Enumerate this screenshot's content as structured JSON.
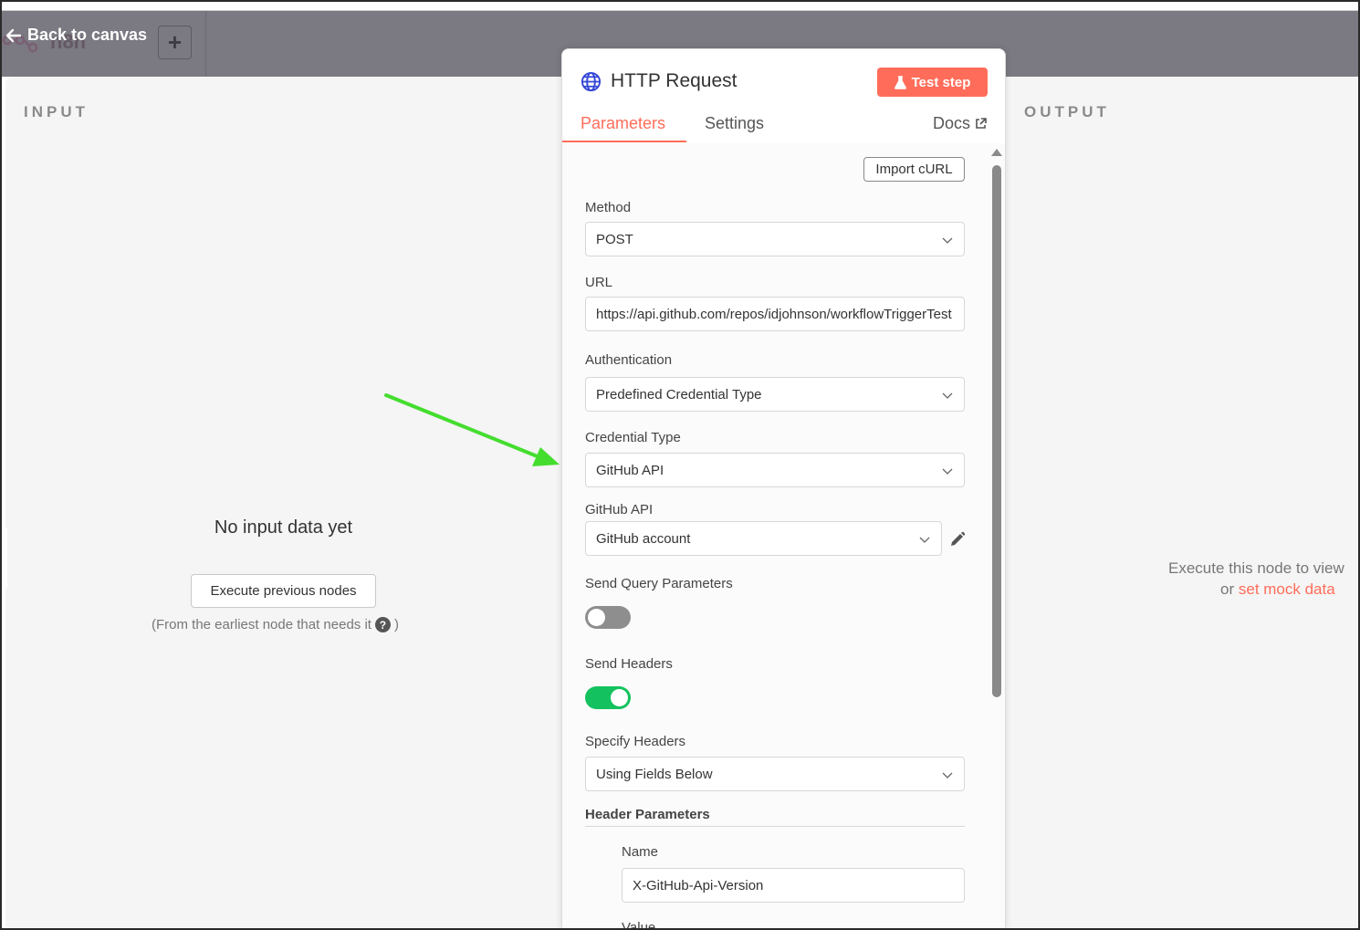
{
  "header": {
    "back_label": "Back to canvas",
    "app_name_ghost": "n8n",
    "add_label": "+"
  },
  "input_pane": {
    "title": "INPUT",
    "empty_message": "No input data yet",
    "execute_button": "Execute previous nodes",
    "note_prefix": "(From the earliest node that needs it",
    "note_suffix": ")",
    "help_icon": "?"
  },
  "output_pane": {
    "title": "OUTPUT",
    "message_line1": "Execute this node to view",
    "message_or": "or",
    "mock_link": "set mock data"
  },
  "node": {
    "icon": "globe-icon",
    "title": "HTTP Request",
    "test_step_label": "Test step",
    "tabs": [
      {
        "label": "Parameters",
        "active": true
      },
      {
        "label": "Settings",
        "active": false
      }
    ],
    "docs_label": "Docs"
  },
  "parameters": {
    "import_curl": "Import cURL",
    "method": {
      "label": "Method",
      "value": "POST"
    },
    "url": {
      "label": "URL",
      "value": "https://api.github.com/repos/idjohnson/workflowTriggerTest"
    },
    "authentication": {
      "label": "Authentication",
      "value": "Predefined Credential Type"
    },
    "credential_type": {
      "label": "Credential Type",
      "value": "GitHub API"
    },
    "github_api": {
      "label": "GitHub API",
      "value": "GitHub account"
    },
    "send_query": {
      "label": "Send Query Parameters",
      "enabled": false
    },
    "send_headers": {
      "label": "Send Headers",
      "enabled": true
    },
    "specify_headers": {
      "label": "Specify Headers",
      "value": "Using Fields Below"
    },
    "header_parameters": {
      "title": "Header Parameters",
      "name_label": "Name",
      "name_value": "X-GitHub-Api-Version",
      "value_label": "Value"
    }
  },
  "colors": {
    "accent": "#ff6d5a",
    "toggle_on": "#13c25e",
    "annotation_arrow": "#44dd2e"
  }
}
